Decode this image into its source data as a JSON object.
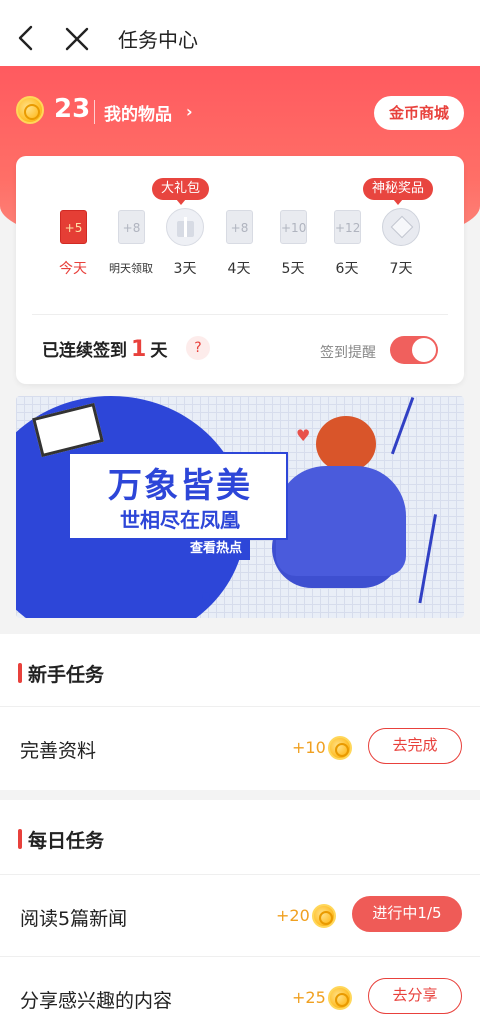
{
  "nav": {
    "title": "任务中心"
  },
  "header": {
    "coins": "23",
    "my_items_label": "我的物品",
    "my_items_arrow": "›",
    "shop_button": "金币商城"
  },
  "signin": {
    "tag_gift": "大礼包",
    "tag_mystery": "神秘奖品",
    "days": [
      {
        "label": "今天",
        "reward": "+5",
        "kind": "redpacket-active"
      },
      {
        "label": "明天领取",
        "reward": "+8",
        "kind": "redpacket"
      },
      {
        "label": "3天",
        "reward": "",
        "kind": "gift"
      },
      {
        "label": "4天",
        "reward": "+8",
        "kind": "redpacket"
      },
      {
        "label": "5天",
        "reward": "+10",
        "kind": "redpacket"
      },
      {
        "label": "6天",
        "reward": "+12",
        "kind": "redpacket"
      },
      {
        "label": "7天",
        "reward": "",
        "kind": "mystery"
      }
    ],
    "streak_prefix": "已连续签到",
    "streak_days": "1",
    "streak_suffix": "天",
    "help_mark": "?",
    "remind_label": "签到提醒",
    "remind_on": true
  },
  "banner": {
    "headline": "万象皆美",
    "subline": "世相尽在凤凰",
    "cta": "查看热点"
  },
  "new_tasks": {
    "title": "新手任务",
    "items": [
      {
        "name": "完善资料",
        "reward": "+10",
        "button": "去完成",
        "filled": false
      }
    ]
  },
  "daily_tasks": {
    "title": "每日任务",
    "items": [
      {
        "name": "阅读5篇新闻",
        "reward": "+20",
        "button": "进行中1/5",
        "filled": true
      },
      {
        "name": "分享感兴趣的内容",
        "reward": "+25",
        "button": "去分享",
        "filled": false
      }
    ]
  },
  "colors": {
    "accent": "#e8413c",
    "header_gradient_top": "#ff5a5f",
    "coin": "#ffc02e",
    "banner_blue": "#2d46d8"
  }
}
